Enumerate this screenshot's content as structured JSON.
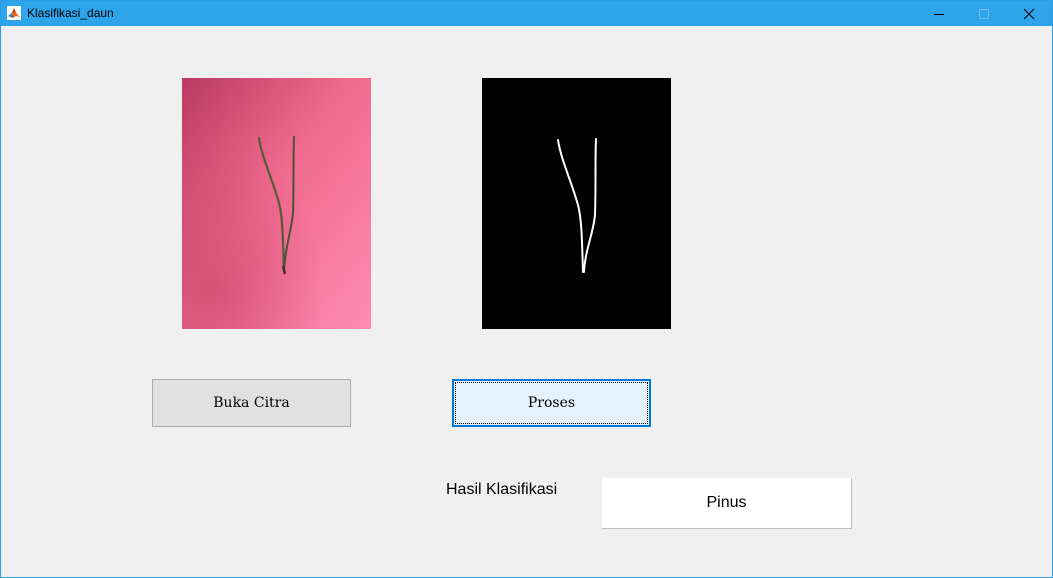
{
  "window": {
    "title": "Klasifikasi_daun",
    "icon": "matlab-icon",
    "controls": [
      "minimize-icon",
      "maximize-icon",
      "close-icon"
    ],
    "titlebar_color": "#2ea4ea",
    "background_color": "#f0f0f0"
  },
  "images": {
    "original": {
      "icon": "leaf-photo",
      "background_colors": [
        "#b83a62",
        "#f06a8e",
        "#ff8ab4"
      ]
    },
    "binary": {
      "icon": "leaf-binary-mask",
      "background_color": "#000000",
      "foreground_color": "#ffffff"
    }
  },
  "buttons": {
    "buka_citra": "Buka Citra",
    "proses": "Proses"
  },
  "result": {
    "label": "Hasil Klasifikasi",
    "value": "Pinus"
  }
}
